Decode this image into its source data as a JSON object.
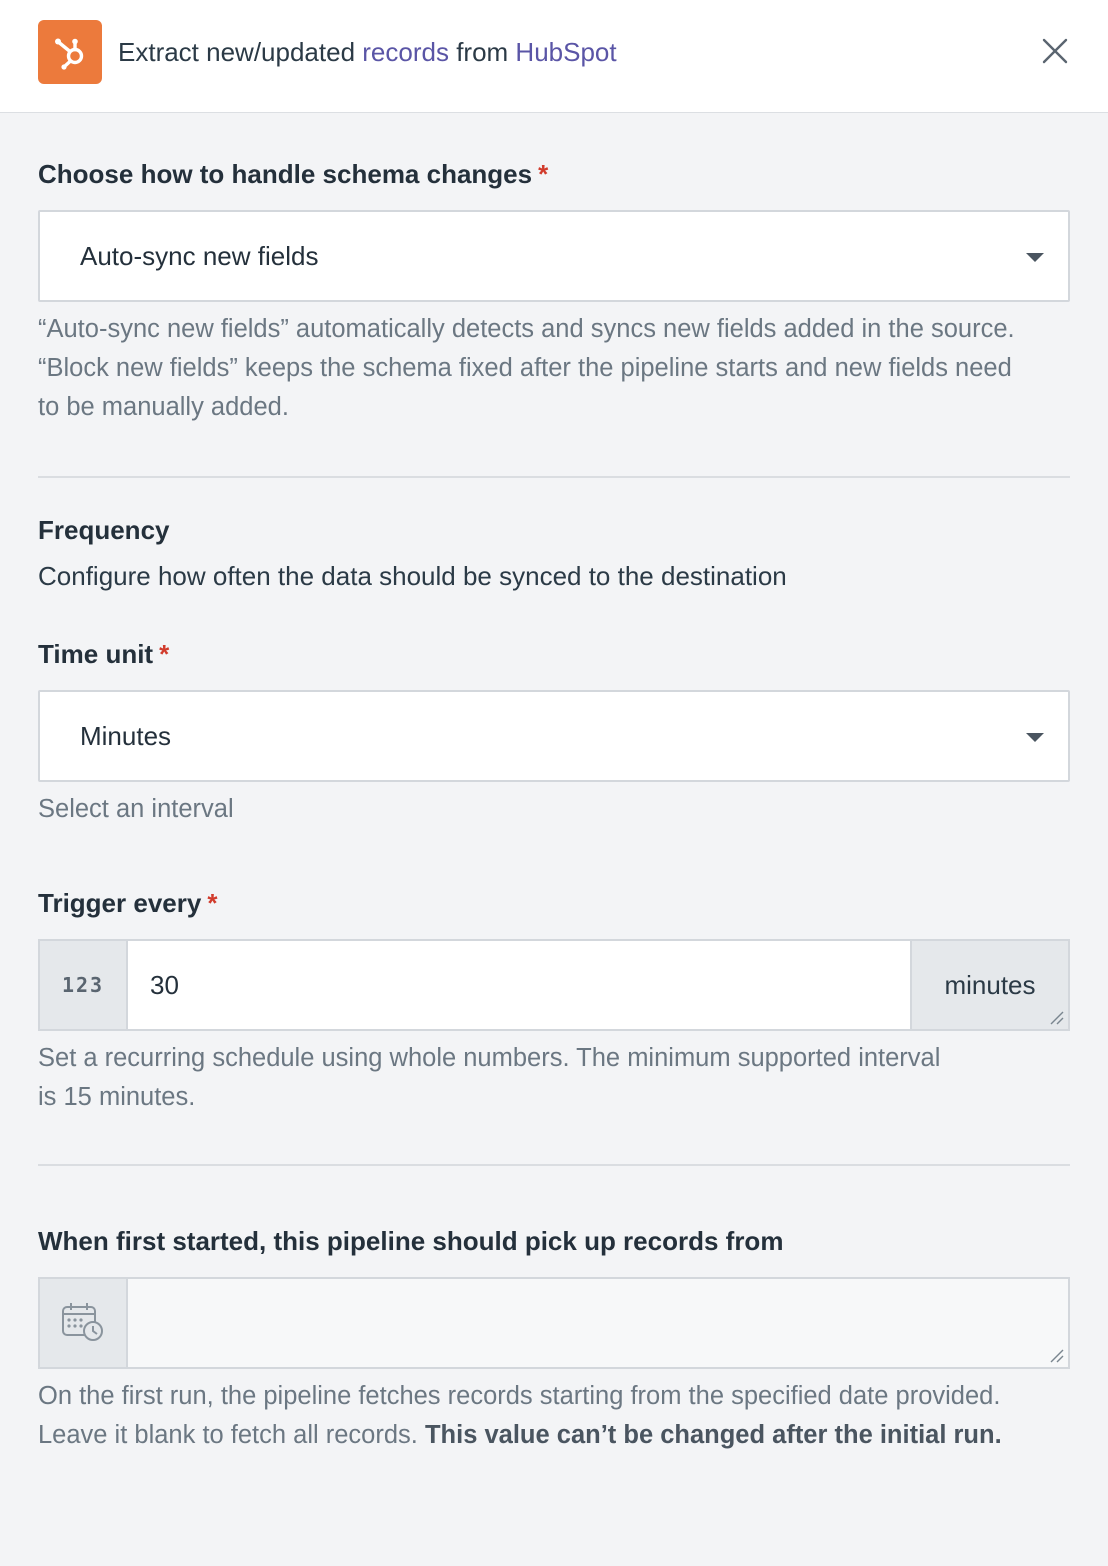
{
  "header": {
    "title_prefix": "Extract new/updated ",
    "title_link1": "records",
    "title_middle": " from ",
    "title_link2": "HubSpot",
    "logo_icon": "hubspot-logo-icon",
    "close_icon": "close-icon"
  },
  "schema": {
    "label": "Choose how to handle schema changes",
    "required_mark": "*",
    "selected": "Auto-sync new fields",
    "help_line1": "“Auto-sync new fields” automatically detects and syncs new fields added in the source.",
    "help_line2": "“Block new fields” keeps the schema fixed after the pipeline starts and new fields need",
    "help_line3": "to be manually added."
  },
  "frequency": {
    "heading": "Frequency",
    "description": "Configure how often the data should be synced to the destination"
  },
  "time_unit": {
    "label": "Time unit",
    "required_mark": "*",
    "selected": "Minutes",
    "help": "Select an interval"
  },
  "trigger": {
    "label": "Trigger every",
    "required_mark": "*",
    "prefix": "123",
    "value": "30",
    "suffix": "minutes",
    "help_line1": "Set a recurring schedule using whole numbers. The minimum supported interval",
    "help_line2": "is 15 minutes."
  },
  "start": {
    "label": "When first started, this pipeline should pick up records from",
    "value": "",
    "calendar_icon": "calendar-clock-icon",
    "help_line1": "On the first run, the pipeline fetches records starting from the specified date provided.",
    "help_line2_regular": "Leave it blank to fetch all records. ",
    "help_line2_bold": "This value can’t be changed after the initial run."
  },
  "colors": {
    "brand_orange": "#ec7a3c",
    "link_purple": "#5a55a6",
    "required_red": "#d13b2c"
  }
}
